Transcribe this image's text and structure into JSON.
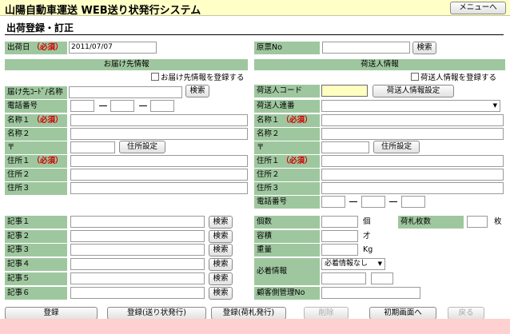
{
  "app": {
    "title": "山陽自動車運送 WEB送り状発行システム",
    "menu_button": "メニューへ"
  },
  "page": {
    "title": "出荷登録・訂正"
  },
  "required_mark": "（必須）",
  "top": {
    "ship_date_label": "出荷日",
    "ship_date_value": "2011/07/07",
    "slip_no_label": "原票No",
    "search_button": "検索"
  },
  "delivery": {
    "header": "お届け先情報",
    "register_checkbox": "お届け先情報を登録する",
    "code_label": "届け先ｺｰﾄﾞ/名称",
    "search_button": "検索",
    "phone_label": "電話番号",
    "name1_label": "名称１",
    "name2_label": "名称２",
    "postal_label": "〒",
    "address_set_button": "住所設定",
    "addr1_label": "住所１",
    "addr2_label": "住所２",
    "addr3_label": "住所３"
  },
  "shipper": {
    "header": "荷送人情報",
    "register_checkbox": "荷送人情報を登録する",
    "code_label": "荷送人コード",
    "settings_button": "荷送人情報設定",
    "contact_label": "荷送人連番",
    "name1_label": "名称１",
    "name2_label": "名称２",
    "postal_label": "〒",
    "address_set_button": "住所設定",
    "addr1_label": "住所１",
    "addr2_label": "住所２",
    "addr3_label": "住所３",
    "phone_label": "電話番号"
  },
  "notes": {
    "labels": [
      "記事１",
      "記事２",
      "記事３",
      "記事４",
      "記事５",
      "記事６"
    ],
    "search_button": "検索"
  },
  "cargo": {
    "count_label": "個数",
    "count_unit": "個",
    "tag_count_label": "荷札枚数",
    "tag_count_unit": "枚",
    "volume_label": "容積",
    "volume_unit": "才",
    "weight_label": "重量",
    "weight_unit": "Kg",
    "arrival_label": "必着情報",
    "arrival_value": "必着情報なし",
    "customer_mgmt_label": "顧客側管理No"
  },
  "actions": {
    "register": "登録",
    "register_slip": "登録(送り状発行)",
    "register_tag": "登録(荷札発行)",
    "delete": "削除",
    "home": "初期画面へ",
    "back": "戻る"
  }
}
